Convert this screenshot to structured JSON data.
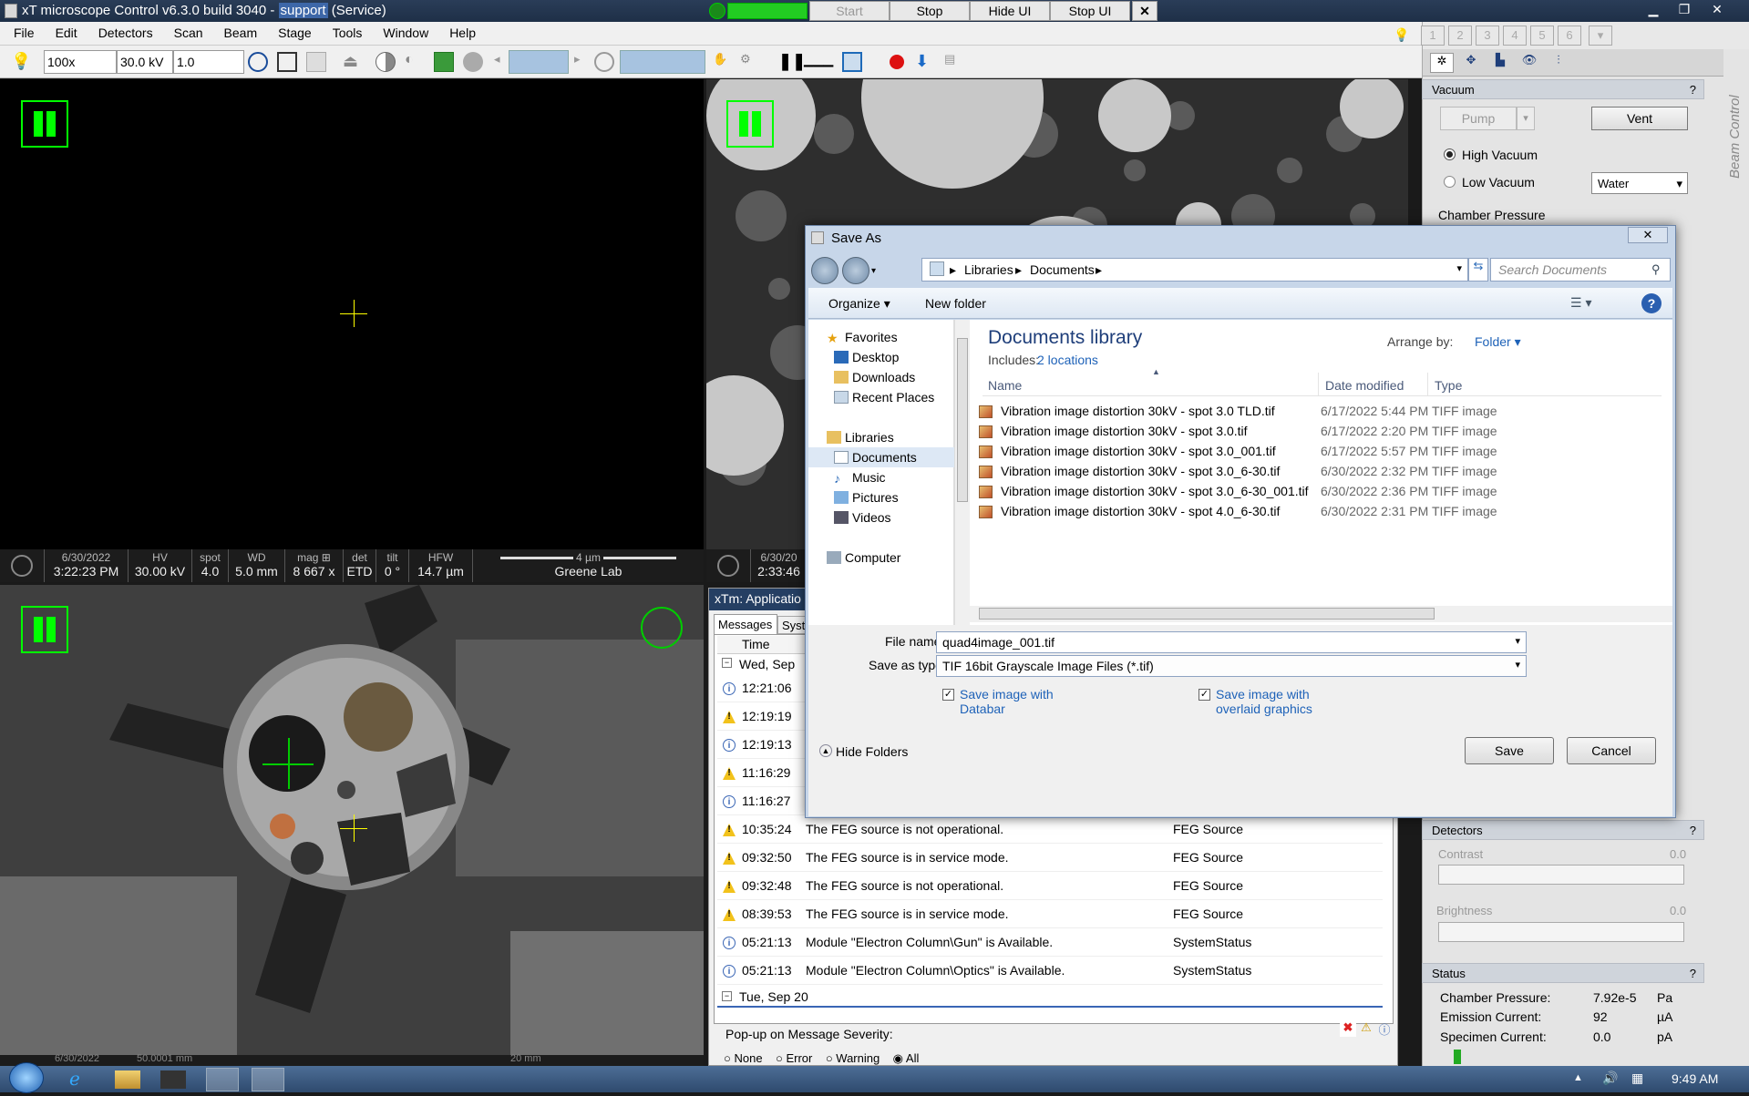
{
  "window": {
    "title_prefix": "xT microscope Control v6.3.0 build 3040 - ",
    "title_highlight": "support",
    "title_suffix": " (Service)",
    "buttons": [
      "Start",
      "Stop",
      "Hide UI",
      "Stop UI"
    ],
    "close": "✕"
  },
  "menu": [
    "File",
    "Edit",
    "Detectors",
    "Scan",
    "Beam",
    "Stage",
    "Tools",
    "Window",
    "Help"
  ],
  "toolbar": {
    "magnification": "100x",
    "high_voltage": "30.0 kV",
    "spot": "1.0"
  },
  "quad1": {
    "databar": {
      "date": "6/30/2022",
      "time": "3:22:23 PM",
      "hv_label": "HV",
      "hv": "30.00 kV",
      "spot_label": "spot",
      "spot": "4.0",
      "wd_label": "WD",
      "wd": "5.0 mm",
      "mag_label": "mag ⊞",
      "mag": "8 667 x",
      "det_label": "det",
      "det": "ETD",
      "tilt_label": "tilt",
      "tilt": "0 °",
      "hfw_label": "HFW",
      "hfw": "14.7 µm",
      "scale": "4 µm",
      "lab": "Greene Lab"
    }
  },
  "quad2": {
    "date": "6/30/20",
    "time": "2:33:46"
  },
  "quad3": {
    "date": "6/30/2022",
    "wd": "50.0001 mm",
    "scale": "20 mm"
  },
  "right_panel": {
    "presets": [
      "1",
      "2",
      "3",
      "4",
      "5",
      "6"
    ],
    "side_label": "Beam Control",
    "vacuum": {
      "title": "Vacuum",
      "help": "?",
      "pump": "Pump",
      "vent": "Vent",
      "high_vacuum": "High Vacuum",
      "low_vacuum": "Low Vacuum",
      "low_vac_gas": "Water",
      "chamber_pressure": "Chamber Pressure"
    },
    "detectors": {
      "title": "Detectors",
      "help": "?",
      "contrast": "Contrast",
      "contrast_value": "0.0",
      "brightness": "Brightness",
      "brightness_value": "0.0"
    },
    "status": {
      "title": "Status",
      "help": "?",
      "rows": [
        {
          "label": "Chamber Pressure:",
          "value": "7.92e-5",
          "unit": "Pa"
        },
        {
          "label": "Emission Current:",
          "value": "92",
          "unit": "µA"
        },
        {
          "label": "Specimen Current:",
          "value": "0.0",
          "unit": "pA"
        }
      ]
    }
  },
  "messages": {
    "title": "xTm: Applicatio",
    "tabs": [
      "Messages",
      "Syst"
    ],
    "col_time": "Time",
    "group1": "Wed, Sep",
    "rows": [
      {
        "type": "info",
        "time": "12:21:06",
        "msg": "",
        "src": ""
      },
      {
        "type": "warn",
        "time": "12:19:19",
        "msg": "",
        "src": ""
      },
      {
        "type": "info",
        "time": "12:19:13",
        "msg": "",
        "src": ""
      },
      {
        "type": "warn",
        "time": "11:16:29",
        "msg": "",
        "src": ""
      },
      {
        "type": "info",
        "time": "11:16:27",
        "msg": "",
        "src": ""
      },
      {
        "type": "warn",
        "time": "10:35:24",
        "msg": "The FEG source is not operational.",
        "src": "FEG Source"
      },
      {
        "type": "warn",
        "time": "09:32:50",
        "msg": "The FEG source is in service mode.",
        "src": "FEG Source"
      },
      {
        "type": "warn",
        "time": "09:32:48",
        "msg": "The FEG source is not operational.",
        "src": "FEG Source"
      },
      {
        "type": "warn",
        "time": "08:39:53",
        "msg": "The FEG source is in service mode.",
        "src": "FEG Source"
      },
      {
        "type": "info",
        "time": "05:21:13",
        "msg": "Module \"Electron Column\\Gun\" is Available.",
        "src": "SystemStatus"
      },
      {
        "type": "info",
        "time": "05:21:13",
        "msg": "Module \"Electron Column\\Optics\" is Available.",
        "src": "SystemStatus"
      }
    ],
    "group2": "Tue, Sep 20",
    "popup_label": "Pop-up on Message Severity:",
    "severity_options": [
      "None",
      "Error",
      "Warning",
      "All"
    ]
  },
  "dialog": {
    "title": "Save As",
    "breadcrumb": [
      "Libraries",
      "Documents"
    ],
    "search_placeholder": "Search Documents",
    "organize": "Organize ▾",
    "new_folder": "New folder",
    "nav": {
      "favorites": "Favorites",
      "desktop": "Desktop",
      "downloads": "Downloads",
      "recent": "Recent Places",
      "libraries": "Libraries",
      "documents": "Documents",
      "music": "Music",
      "pictures": "Pictures",
      "videos": "Videos",
      "computer": "Computer"
    },
    "library_title": "Documents library",
    "includes_label": "Includes:",
    "includes_link": "2 locations",
    "arrange_by": "Arrange by:",
    "arrange_value": "Folder ▾",
    "columns": {
      "name": "Name",
      "date": "Date modified",
      "type": "Type"
    },
    "files": [
      {
        "name": "Vibration image distortion 30kV - spot 3.0 TLD.tif",
        "date": "6/17/2022 5:44 PM",
        "type": "TIFF image"
      },
      {
        "name": "Vibration image distortion 30kV - spot 3.0.tif",
        "date": "6/17/2022 2:20 PM",
        "type": "TIFF image"
      },
      {
        "name": "Vibration image distortion 30kV - spot 3.0_001.tif",
        "date": "6/17/2022 5:57 PM",
        "type": "TIFF image"
      },
      {
        "name": "Vibration image distortion 30kV - spot 3.0_6-30.tif",
        "date": "6/30/2022 2:32 PM",
        "type": "TIFF image"
      },
      {
        "name": "Vibration image distortion 30kV - spot 3.0_6-30_001.tif",
        "date": "6/30/2022 2:36 PM",
        "type": "TIFF image"
      },
      {
        "name": "Vibration image distortion 30kV - spot 4.0_6-30.tif",
        "date": "6/30/2022 2:31 PM",
        "type": "TIFF image"
      }
    ],
    "file_name_label": "File name:",
    "file_name_value": "quad4image_001.tif",
    "save_type_label": "Save as type:",
    "save_type_value": "TIF 16bit Grayscale Image Files (*.tif)",
    "chk_databar_1": "Save image with",
    "chk_databar_2": "Databar",
    "chk_overlay_1": "Save image with",
    "chk_overlay_2": "overlaid graphics",
    "hide_folders": "Hide Folders",
    "save": "Save",
    "cancel": "Cancel"
  },
  "taskbar": {
    "clock": "9:49 AM"
  }
}
